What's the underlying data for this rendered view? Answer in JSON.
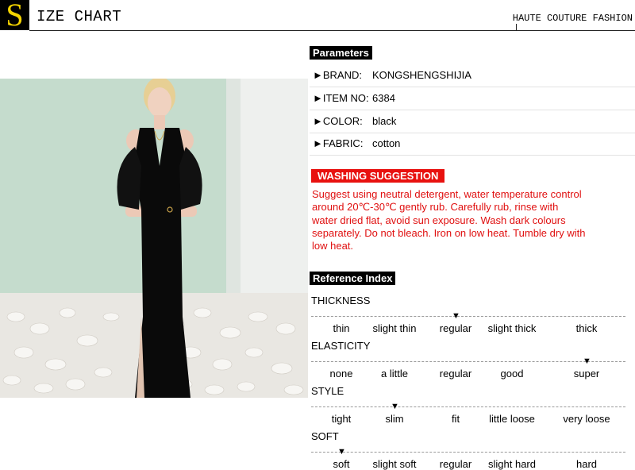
{
  "header": {
    "s_letter": "S",
    "title_rest": "IZE CHART",
    "right_text": "HAUTE COUTURE FASHION"
  },
  "parameters": {
    "title": "Parameters",
    "rows": [
      {
        "label": "►BRAND:",
        "value": "KONGSHENGSHIJIA"
      },
      {
        "label": "►ITEM NO:",
        "value": "6384"
      },
      {
        "label": "►COLOR:",
        "value": "black"
      },
      {
        "label": "►FABRIC:",
        "value": "cotton"
      }
    ]
  },
  "washing": {
    "title": "WASHING SUGGESTION",
    "text": "Suggest using neutral detergent, water temperature control around 20℃-30℃ gently rub. Carefully rub, rinse with water dried flat, avoid sun exposure. Wash dark colours separately. Do not bleach. Iron on low heat. Tumble dry with low heat."
  },
  "reference": {
    "title": "Reference Index",
    "marker": "▼",
    "categories": [
      {
        "name": "THICKNESS",
        "options": [
          "thin",
          "slight thin",
          "regular",
          "slight thick",
          "thick"
        ],
        "selected": "regular"
      },
      {
        "name": "ELASTICITY",
        "options": [
          "none",
          "a little",
          "regular",
          "good",
          "super"
        ],
        "selected": "super"
      },
      {
        "name": "STYLE",
        "options": [
          "tight",
          "slim",
          "fit",
          "little loose",
          "very loose"
        ],
        "selected": "slim"
      },
      {
        "name": "SOFT",
        "options": [
          "soft",
          "slight soft",
          "regular",
          "slight hard",
          "hard"
        ],
        "selected": "soft"
      }
    ]
  },
  "colors": {
    "accent_red": "#e8110f",
    "yellow": "#f5d400",
    "dress": "#0a0a0a",
    "wall": "#c6ddce"
  }
}
